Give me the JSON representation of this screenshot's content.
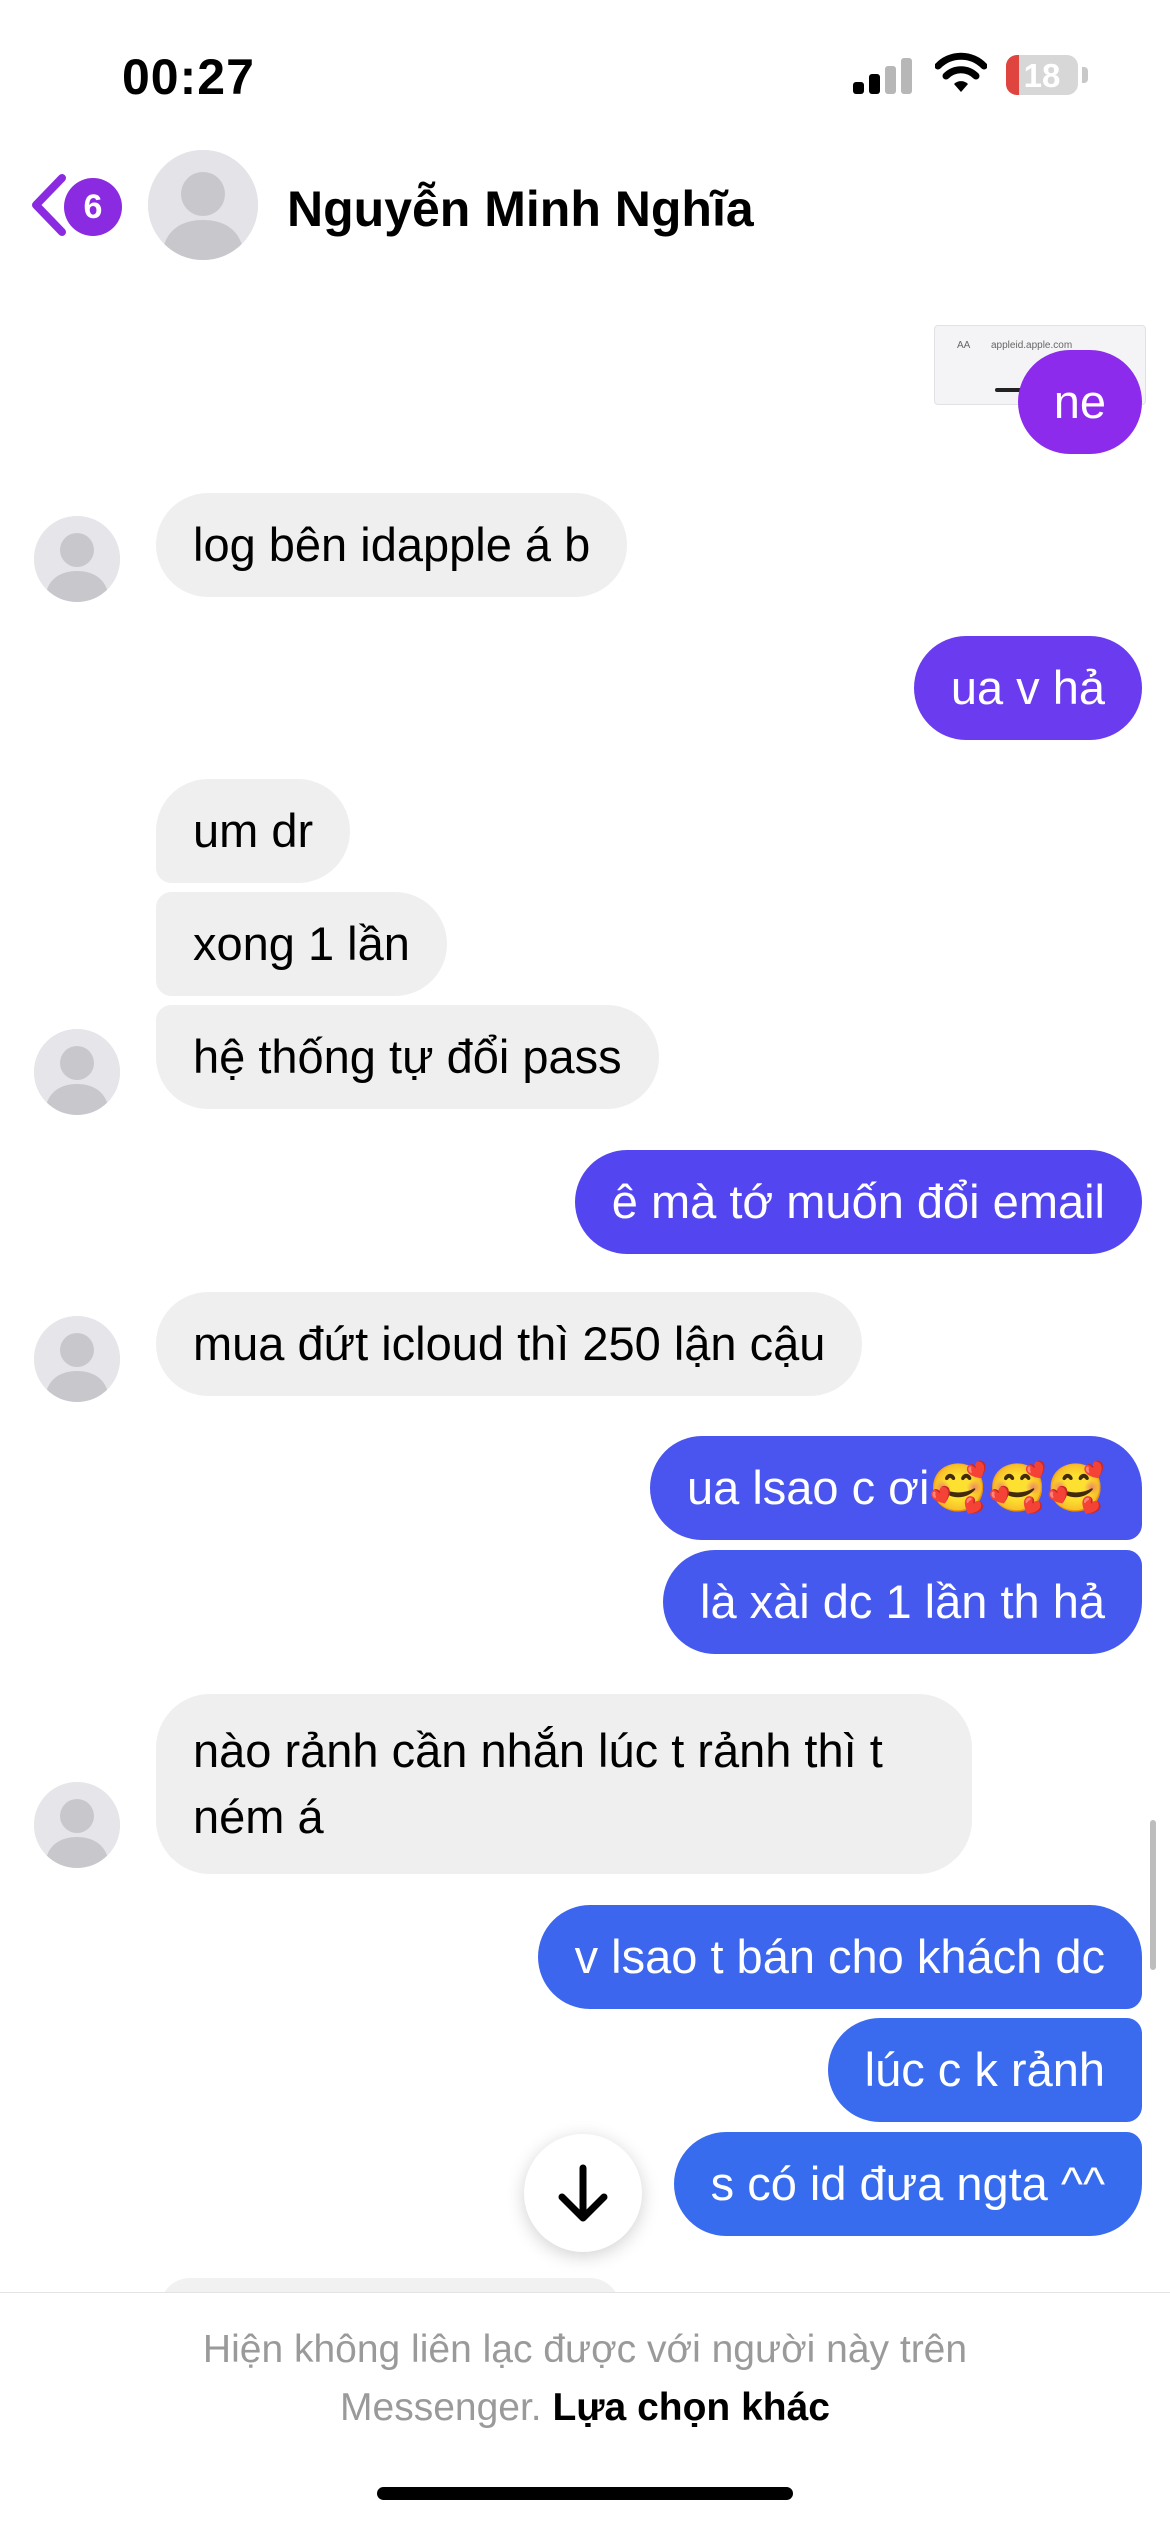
{
  "status_bar": {
    "time": "00:27",
    "battery_level": "18",
    "icons": [
      "cellular-signal-icon",
      "wifi-icon",
      "battery-icon"
    ]
  },
  "header": {
    "back_badge": "6",
    "contact_name": "Nguyễn Minh Nghĩa",
    "icons": [
      "chevron-left-icon",
      "avatar-placeholder-icon"
    ]
  },
  "thumbnail": {
    "aa": "AA",
    "url": "appleid.apple.com"
  },
  "messages": [
    {
      "dir": "out",
      "text": "ne",
      "color": "#8C2BEB"
    },
    {
      "dir": "in",
      "text": "log bên idapple á b"
    },
    {
      "dir": "out",
      "text": "ua v hả",
      "color": "#6B3BF0"
    },
    {
      "dir": "in",
      "text": "um dr"
    },
    {
      "dir": "in",
      "text": "xong 1 lần"
    },
    {
      "dir": "in",
      "text": "hệ thống tự đổi pass"
    },
    {
      "dir": "out",
      "text": "ê mà tớ muốn đổi email",
      "color": "#5346F0"
    },
    {
      "dir": "in",
      "text": "mua đứt icloud thì 250 lận cậu"
    },
    {
      "dir": "out",
      "text": "ua lsao c ơi🥰🥰🥰",
      "color": "#4A54EE"
    },
    {
      "dir": "out",
      "text": "là xài dc 1 lần th hả",
      "color": "#4659EE"
    },
    {
      "dir": "in",
      "text": "nào rảnh cần nhắn lúc t rảnh thì t ném á"
    },
    {
      "dir": "out",
      "text": "v lsao t bán cho khách dc",
      "color": "#3C66EE"
    },
    {
      "dir": "out",
      "text": "lúc c k rảnh",
      "color": "#3A6AEE"
    },
    {
      "dir": "out",
      "text": "s có id đưa ngta ^^",
      "color": "#386CEF"
    }
  ],
  "footer": {
    "notice": "Hiện không liên lạc được với người này trên Messenger.",
    "notice_line1": "Hiện không liên lạc được với người này trên",
    "notice_line2": "Messenger.",
    "link": "Lựa chọn khác"
  },
  "scroll_down_icon": "arrow-down-icon"
}
